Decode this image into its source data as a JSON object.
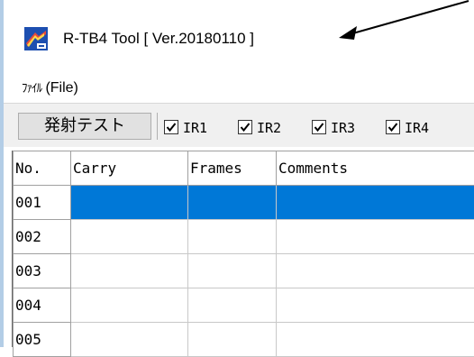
{
  "window": {
    "title": "R-TB4 Tool  [ Ver.20180110 ]",
    "icon": "app-icon",
    "accent_color": "#0078d7"
  },
  "menu": {
    "file_jp": "ﾌｧｲﾙ",
    "file_en": " (File)"
  },
  "toolbar": {
    "fire_test_label": "発射テスト",
    "checkboxes": [
      {
        "label": "IR1",
        "checked": true
      },
      {
        "label": "IR2",
        "checked": true
      },
      {
        "label": "IR3",
        "checked": true
      },
      {
        "label": "IR4",
        "checked": true
      }
    ]
  },
  "grid": {
    "columns": [
      "No.",
      "Carry",
      "Frames",
      "Comments"
    ],
    "rows": [
      {
        "no": "001",
        "carry": "",
        "frames": "",
        "comments": "",
        "selected": true
      },
      {
        "no": "002",
        "carry": "",
        "frames": "",
        "comments": ""
      },
      {
        "no": "003",
        "carry": "",
        "frames": "",
        "comments": ""
      },
      {
        "no": "004",
        "carry": "",
        "frames": "",
        "comments": ""
      },
      {
        "no": "005",
        "carry": "",
        "frames": "",
        "comments": ""
      }
    ]
  }
}
